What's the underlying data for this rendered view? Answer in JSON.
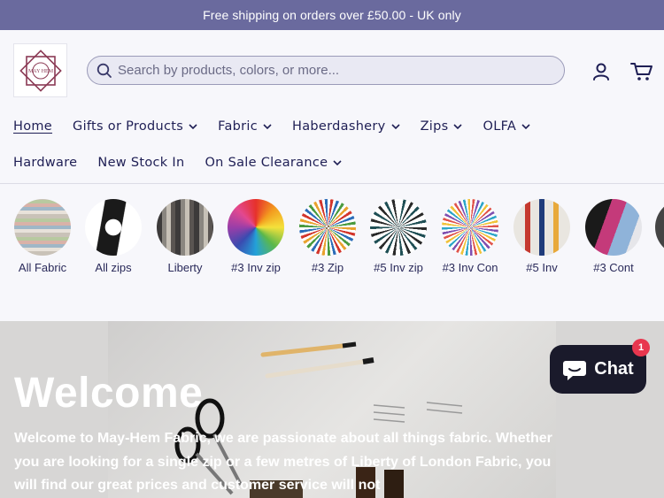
{
  "announcement": "Free shipping on orders over £50.00 - UK only",
  "header": {
    "search_placeholder": "Search by products, colors, or more...",
    "logo_text": "MAY HEM",
    "account_icon": "user-icon",
    "cart_icon": "cart-icon"
  },
  "nav": {
    "row1": [
      {
        "label": "Home",
        "active": true,
        "dropdown": false
      },
      {
        "label": "Gifts or Products",
        "dropdown": true
      },
      {
        "label": "Fabric",
        "dropdown": true
      },
      {
        "label": "Haberdashery",
        "dropdown": true
      },
      {
        "label": "Zips",
        "dropdown": true
      },
      {
        "label": "OLFA",
        "dropdown": true
      }
    ],
    "row2": [
      {
        "label": "Hardware",
        "dropdown": false
      },
      {
        "label": "New Stock In",
        "dropdown": false
      },
      {
        "label": "On Sale Clearance",
        "dropdown": true
      }
    ]
  },
  "categories": [
    {
      "label": "All Fabric"
    },
    {
      "label": "All zips"
    },
    {
      "label": "Liberty"
    },
    {
      "label": "#3 Inv zip"
    },
    {
      "label": "#3 Zip"
    },
    {
      "label": "#5 Inv zip"
    },
    {
      "label": "#3 Inv Con"
    },
    {
      "label": "#5 Inv"
    },
    {
      "label": "#3 Cont"
    }
  ],
  "hero": {
    "title": "Welcome",
    "text": "Welcome to May-Hem Fabric, we are passionate about all things fabric. Whether you are looking for a single zip or a few metres of Liberty of London Fabric, you will find our great prices and customer service will not"
  },
  "chat": {
    "label": "Chat",
    "badge": "1"
  },
  "colors": {
    "announcement_bg": "#6a6a9e",
    "text_primary": "#1f1f55",
    "chat_bg": "#1a1a2b",
    "badge_bg": "#e8364e"
  }
}
